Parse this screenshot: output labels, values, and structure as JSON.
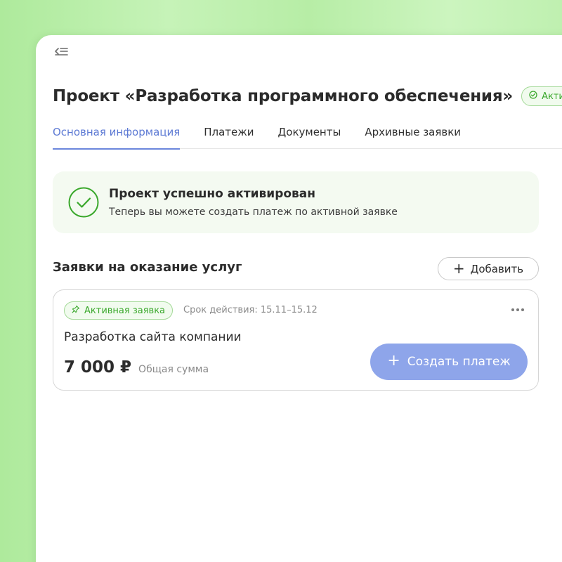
{
  "header": {
    "menu_icon": "collapse-menu-icon",
    "title": "Проект «Разработка программного обеспечения»",
    "status_label": "Акти",
    "status_icon": "check-circle-icon"
  },
  "tabs": [
    {
      "label": "Основная информация",
      "active": true
    },
    {
      "label": "Платежи",
      "active": false
    },
    {
      "label": "Документы",
      "active": false
    },
    {
      "label": "Архивные заявки",
      "active": false
    }
  ],
  "alert": {
    "icon": "check-circle-icon",
    "title": "Проект успешно активирован",
    "description": "Теперь вы можете создать платеж по активной заявке"
  },
  "section": {
    "title": "Заявки на оказание услуг",
    "add_label": "Добавить",
    "add_icon": "plus-icon"
  },
  "request": {
    "badge_icon": "pin-icon",
    "badge_label": "Активная заявка",
    "validity": "Срок действия: 15.11–15.12",
    "more_icon": "more-horizontal-icon",
    "title": "Разработка сайта компании",
    "amount": "7 000 ₽",
    "amount_label": "Общая сумма",
    "pay_label": "Создать платеж",
    "pay_icon": "plus-icon"
  },
  "colors": {
    "accent": "#6b86dc",
    "button_primary": "#8ea5ea",
    "success": "#3aa82c",
    "success_bg": "#f4faf1",
    "background": "#c6f3b8"
  }
}
